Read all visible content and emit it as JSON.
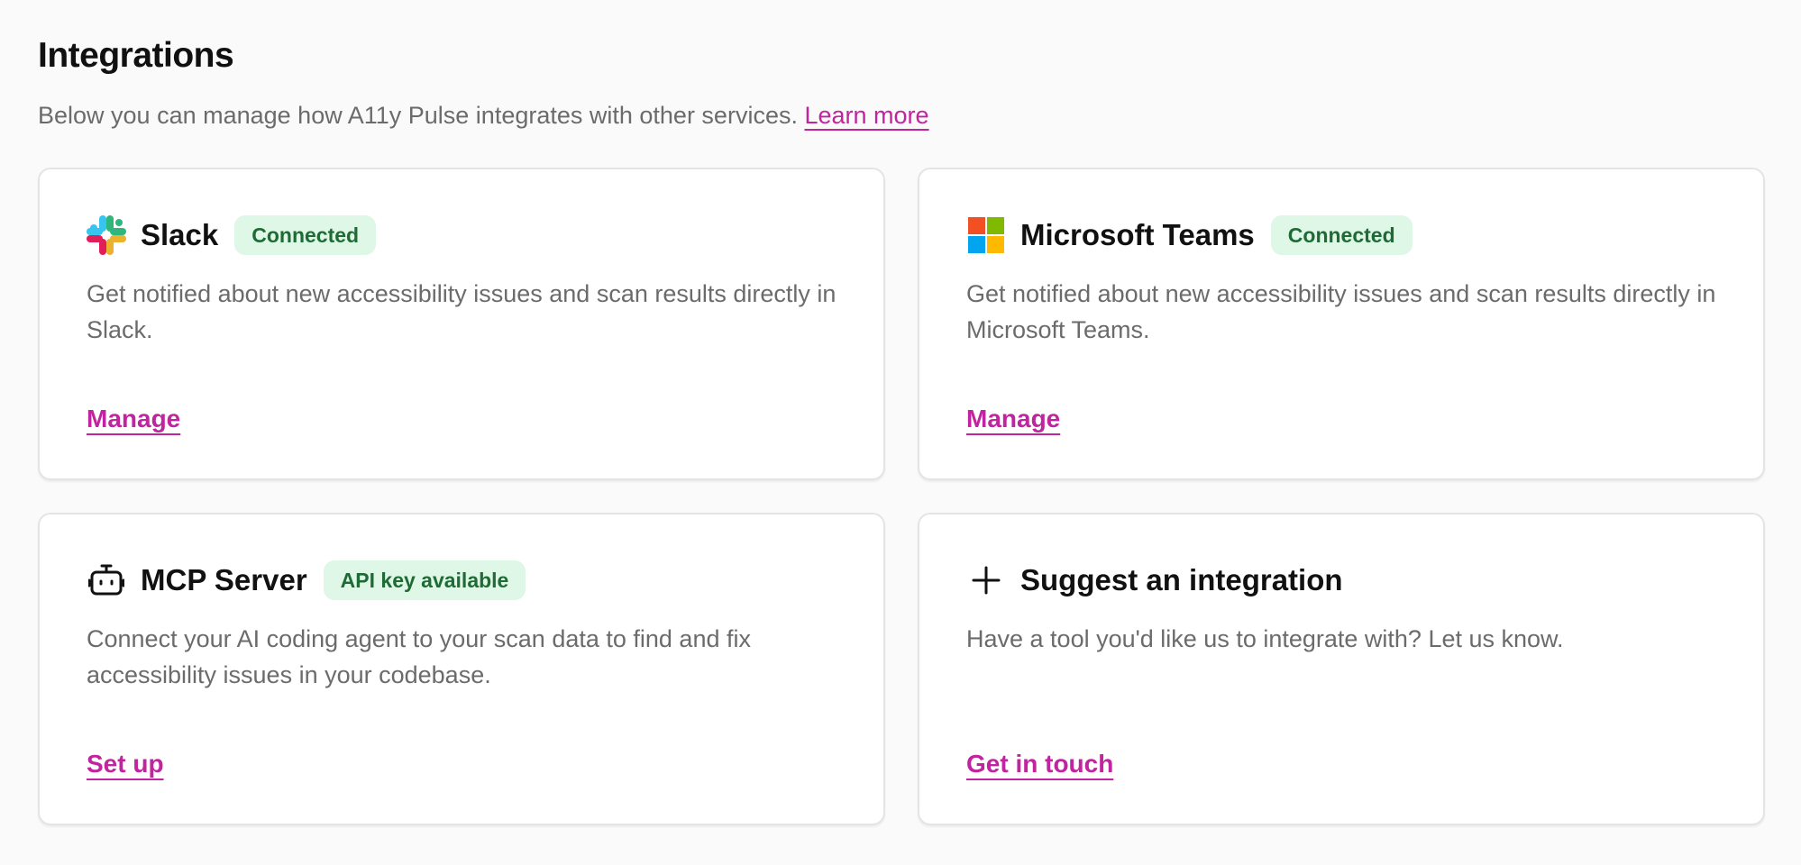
{
  "page": {
    "title": "Integrations",
    "intro_text": "Below you can manage how A11y Pulse integrates with other services.",
    "intro_link": "Learn more"
  },
  "cards": [
    {
      "icon": "slack-logo-icon",
      "title": "Slack",
      "badge": "Connected",
      "description": "Get notified about new accessibility issues and scan results directly in Slack.",
      "action": "Manage"
    },
    {
      "icon": "microsoft-logo-icon",
      "title": "Microsoft Teams",
      "badge": "Connected",
      "description": "Get notified about new accessibility issues and scan results directly in Microsoft Teams.",
      "action": "Manage"
    },
    {
      "icon": "robot-icon",
      "title": "MCP Server",
      "badge": "API key available",
      "description": "Connect your AI coding agent to your scan data to find and fix accessibility issues in your codebase.",
      "action": "Set up"
    },
    {
      "icon": "plus-icon",
      "title": "Suggest an integration",
      "description": "Have a tool you'd like us to integrate with? Let us know.",
      "action": "Get in touch"
    }
  ],
  "colors": {
    "accent_link": "#c0249f",
    "badge_bg": "#dff7e6",
    "badge_text": "#1f6b35",
    "muted_text": "#6b6b6b"
  }
}
